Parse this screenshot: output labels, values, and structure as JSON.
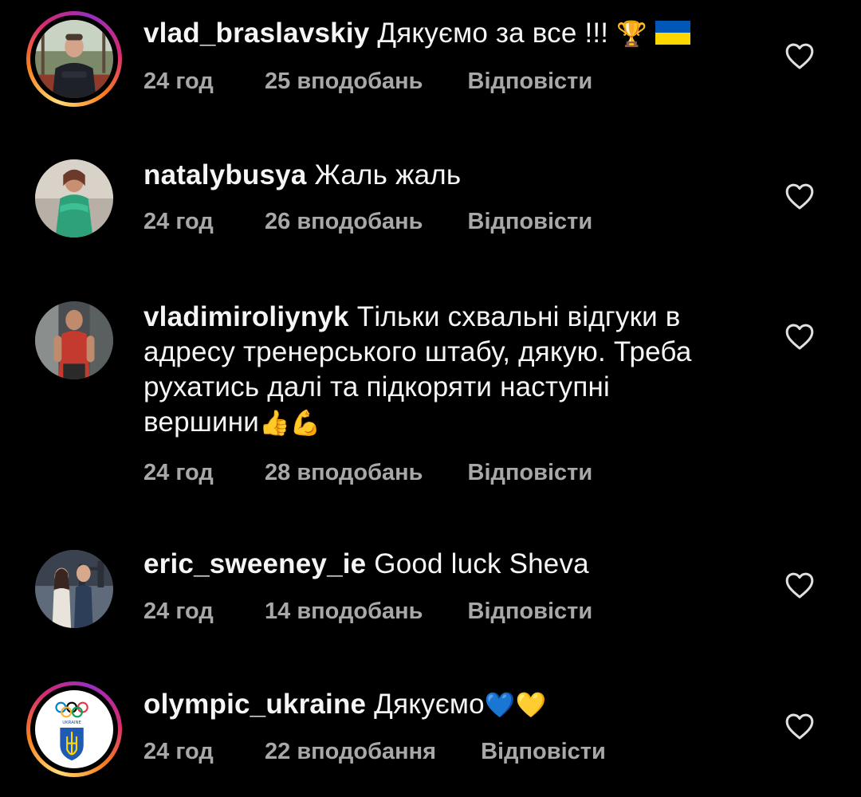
{
  "comments": [
    {
      "username": "vlad_braslavskiy",
      "text": "Дякуємо за все !!!",
      "emoji": "🏆",
      "flag": "ukraine-flag",
      "time": "24 год",
      "likes": "25 вподобань",
      "reply": "Відповісти",
      "avatar": "avatar-man-sportswear",
      "story_ring": true
    },
    {
      "username": "natalybusya",
      "text": "Жаль жаль",
      "time": "24 год",
      "likes": "26 вподобань",
      "reply": "Відповісти",
      "avatar": "avatar-woman-green-dress"
    },
    {
      "username": "vladimiroliynyk",
      "text_lines": [
        "Тільки схвальні відгуки в",
        "адресу тренерського штабу, дякую. Треба",
        "рухатись далі та підкоряти наступні",
        "вершини"
      ],
      "emoji": "👍💪",
      "time": "24 год",
      "likes": "28 вподобань",
      "reply": "Відповісти",
      "avatar": "avatar-man-gym"
    },
    {
      "username": "eric_sweeney_ie",
      "text": "Good luck Sheva",
      "time": "24 год",
      "likes": "14 вподобань",
      "reply": "Відповісти",
      "avatar": "avatar-couple-bridge"
    },
    {
      "username": "olympic_ukraine",
      "text": "Дякуємо",
      "emoji": "💙💛",
      "time": "24 год",
      "likes": "22 вподобання",
      "reply": "Відповісти",
      "avatar": "avatar-olympic-ukraine-logo",
      "avatar_text": "UKRAINE",
      "story_ring": true
    }
  ],
  "colors": {
    "background": "#000000",
    "text": "#f5f5f5",
    "meta": "#a8a8a8",
    "heart": "#e0e0e0",
    "flag_blue": "#0057b7",
    "flag_yellow": "#ffd700"
  }
}
